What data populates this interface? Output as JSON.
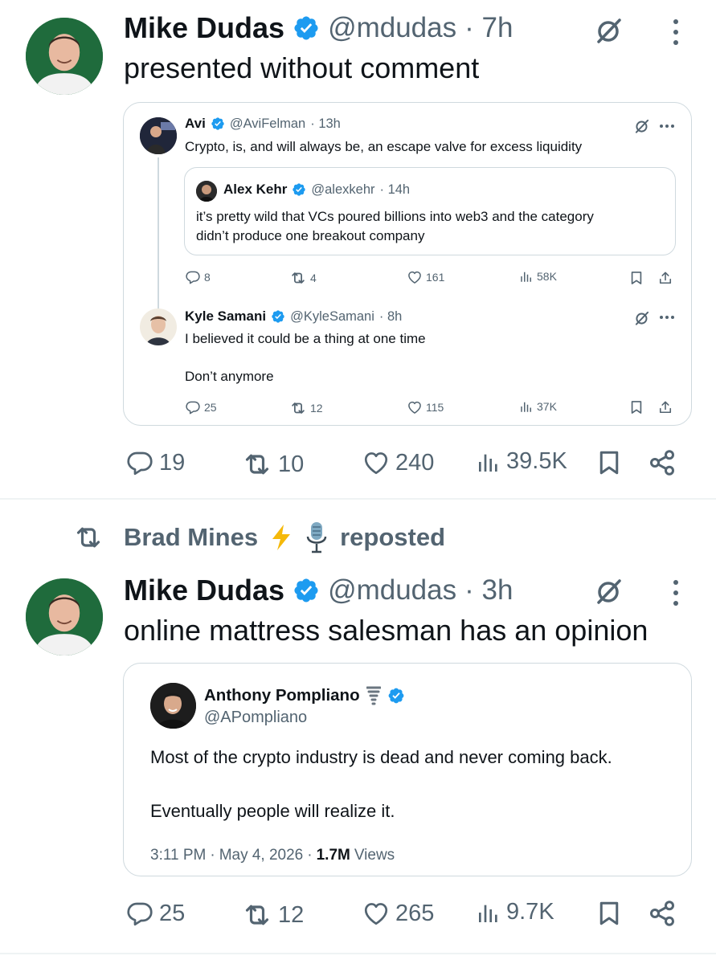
{
  "post1": {
    "author_name": "Mike Dudas",
    "handle": "@mdudas",
    "time": "· 7h",
    "text": "presented without comment",
    "quote": {
      "author_name": "Avi",
      "handle": "@AviFelman",
      "time": "· 13h",
      "text": "Crypto, is, and will always be, an escape valve for excess liquidity",
      "nested_quote": {
        "author_name": "Alex Kehr",
        "handle": "@alexkehr",
        "time": "· 14h",
        "text_lines": [
          "it’s pretty wild that VCs poured billions into web3 and the category",
          "didn’t produce one breakout company"
        ]
      },
      "stats": {
        "replies": "8",
        "reposts": "4",
        "likes": "161",
        "views": "58K"
      },
      "reply": {
        "author_name": "Kyle Samani",
        "handle": "@KyleSamani",
        "time": "· 8h",
        "line1": "I believed it could be a thing at one time",
        "line2": "Don’t anymore",
        "stats": {
          "replies": "25",
          "reposts": "12",
          "likes": "115",
          "views": "37K"
        }
      }
    },
    "stats": {
      "replies": "19",
      "reposts": "10",
      "likes": "240",
      "views": "39.5K"
    }
  },
  "repost_banner": {
    "name": "Brad Mines",
    "label": "reposted"
  },
  "post2": {
    "author_name": "Mike Dudas",
    "handle": "@mdudas",
    "time": "· 3h",
    "text": "online mattress salesman has an opinion",
    "quote": {
      "author_name": "Anthony Pompliano",
      "handle": "@APompliano",
      "line1": "Most of the crypto industry is dead and never coming back.",
      "line2": "Eventually people will realize it.",
      "time": "3:11 PM",
      "date": "May 4, 2026",
      "views_count": "1.7M",
      "views_label": "Views"
    },
    "stats": {
      "replies": "25",
      "reposts": "12",
      "likes": "265",
      "views": "9.7K"
    }
  },
  "colors": {
    "verified": "#1d9bf0",
    "muted": "#536471",
    "border": "#cfd9de"
  },
  "icons": [
    "verified-badge-icon",
    "grok-icon",
    "more-vertical-icon",
    "more-horizontal-icon",
    "reply-icon",
    "repost-icon",
    "like-icon",
    "views-icon",
    "bookmark-icon",
    "share-icon",
    "lightning-icon",
    "microphone-icon",
    "tornado-icon"
  ]
}
